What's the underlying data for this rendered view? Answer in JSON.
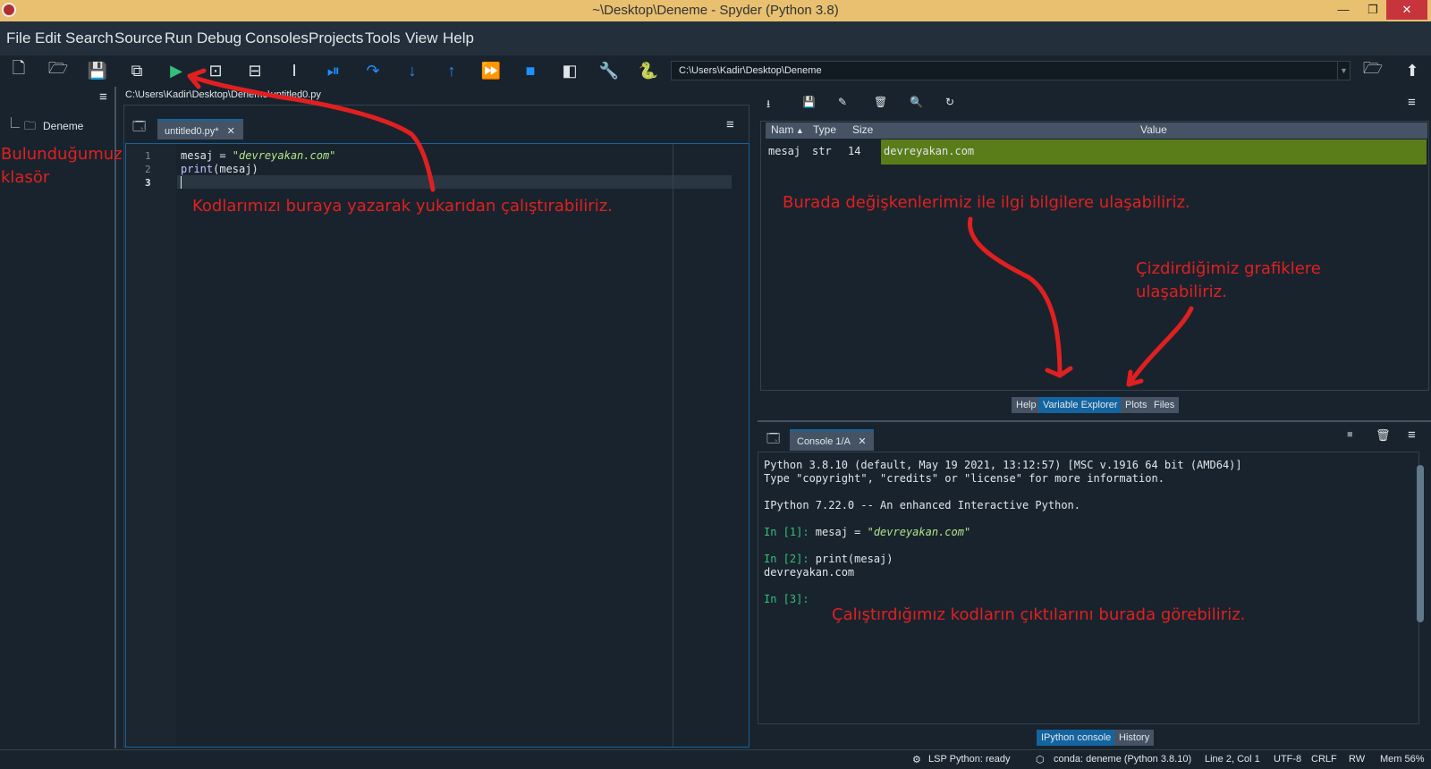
{
  "window": {
    "title": "~\\Desktop\\Deneme - Spyder (Python 3.8)",
    "min": "—",
    "max": "❐",
    "close": "✕"
  },
  "menu": [
    "File",
    "Edit",
    "Search",
    "Source",
    "Run",
    "Debug",
    "Consoles",
    "Projects",
    "Tools",
    "View",
    "Help"
  ],
  "toolbar": {
    "path": "C:\\Users\\Kadir\\Desktop\\Deneme"
  },
  "files": {
    "folder": "Deneme"
  },
  "editor": {
    "path": "C:\\Users\\Kadir\\Desktop\\Deneme\\untitled0.py",
    "tab": "untitled0.py*",
    "lines": [
      "1",
      "2",
      "3"
    ],
    "code1_a": "mesaj = ",
    "code1_b": "\"devreyakan.com\"",
    "code2_a": "print",
    "code2_b": "(mesaj)"
  },
  "variables": {
    "headers": [
      "Nam",
      "Type",
      "Size",
      "Value"
    ],
    "row": {
      "name": "mesaj",
      "type": "str",
      "size": "14",
      "value": "devreyakan.com"
    }
  },
  "pane_tabs": [
    "Help",
    "Variable Explorer",
    "Plots",
    "Files"
  ],
  "console": {
    "tab": "Console 1/A",
    "lines": [
      "Python 3.8.10 (default, May 19 2021, 13:12:57) [MSC v.1916 64 bit (AMD64)]",
      "Type \"copyright\", \"credits\" or \"license\" for more information.",
      "IPython 7.22.0 -- An enhanced Interactive Python."
    ],
    "in1": "In [1]: ",
    "in1_code": "mesaj = ",
    "in1_str": "\"devreyakan.com\"",
    "in2": "In [2]: ",
    "in2_code": "print(mesaj)",
    "out2": "devreyakan.com",
    "in3": "In [3]:"
  },
  "console_tabs": [
    "IPython console",
    "History"
  ],
  "status": {
    "lsp": "LSP Python: ready",
    "conda": "conda: deneme (Python 3.8.10)",
    "pos": "Line 2, Col 1",
    "enc": "UTF-8",
    "eol": "CRLF",
    "rw": "RW",
    "mem": "Mem 56%"
  },
  "annotations": {
    "folder": "Bulunduğumuz klasör",
    "editor": "Kodlarımızı buraya yazarak yukarıdan çalıştırabiliriz.",
    "variables": "Burada değişkenlerimiz ile ilgi bilgilere ulaşabiliriz.",
    "plots": "Çizdirdiğimiz grafiklere ulaşabiliriz.",
    "console": "Çalıştırdığımız kodların çıktılarını burada görebiliriz."
  },
  "colors": {
    "accent": "#1464a0",
    "annotation": "#e02020",
    "run": "#34c07a",
    "value_bg": "#5a7d1a"
  }
}
